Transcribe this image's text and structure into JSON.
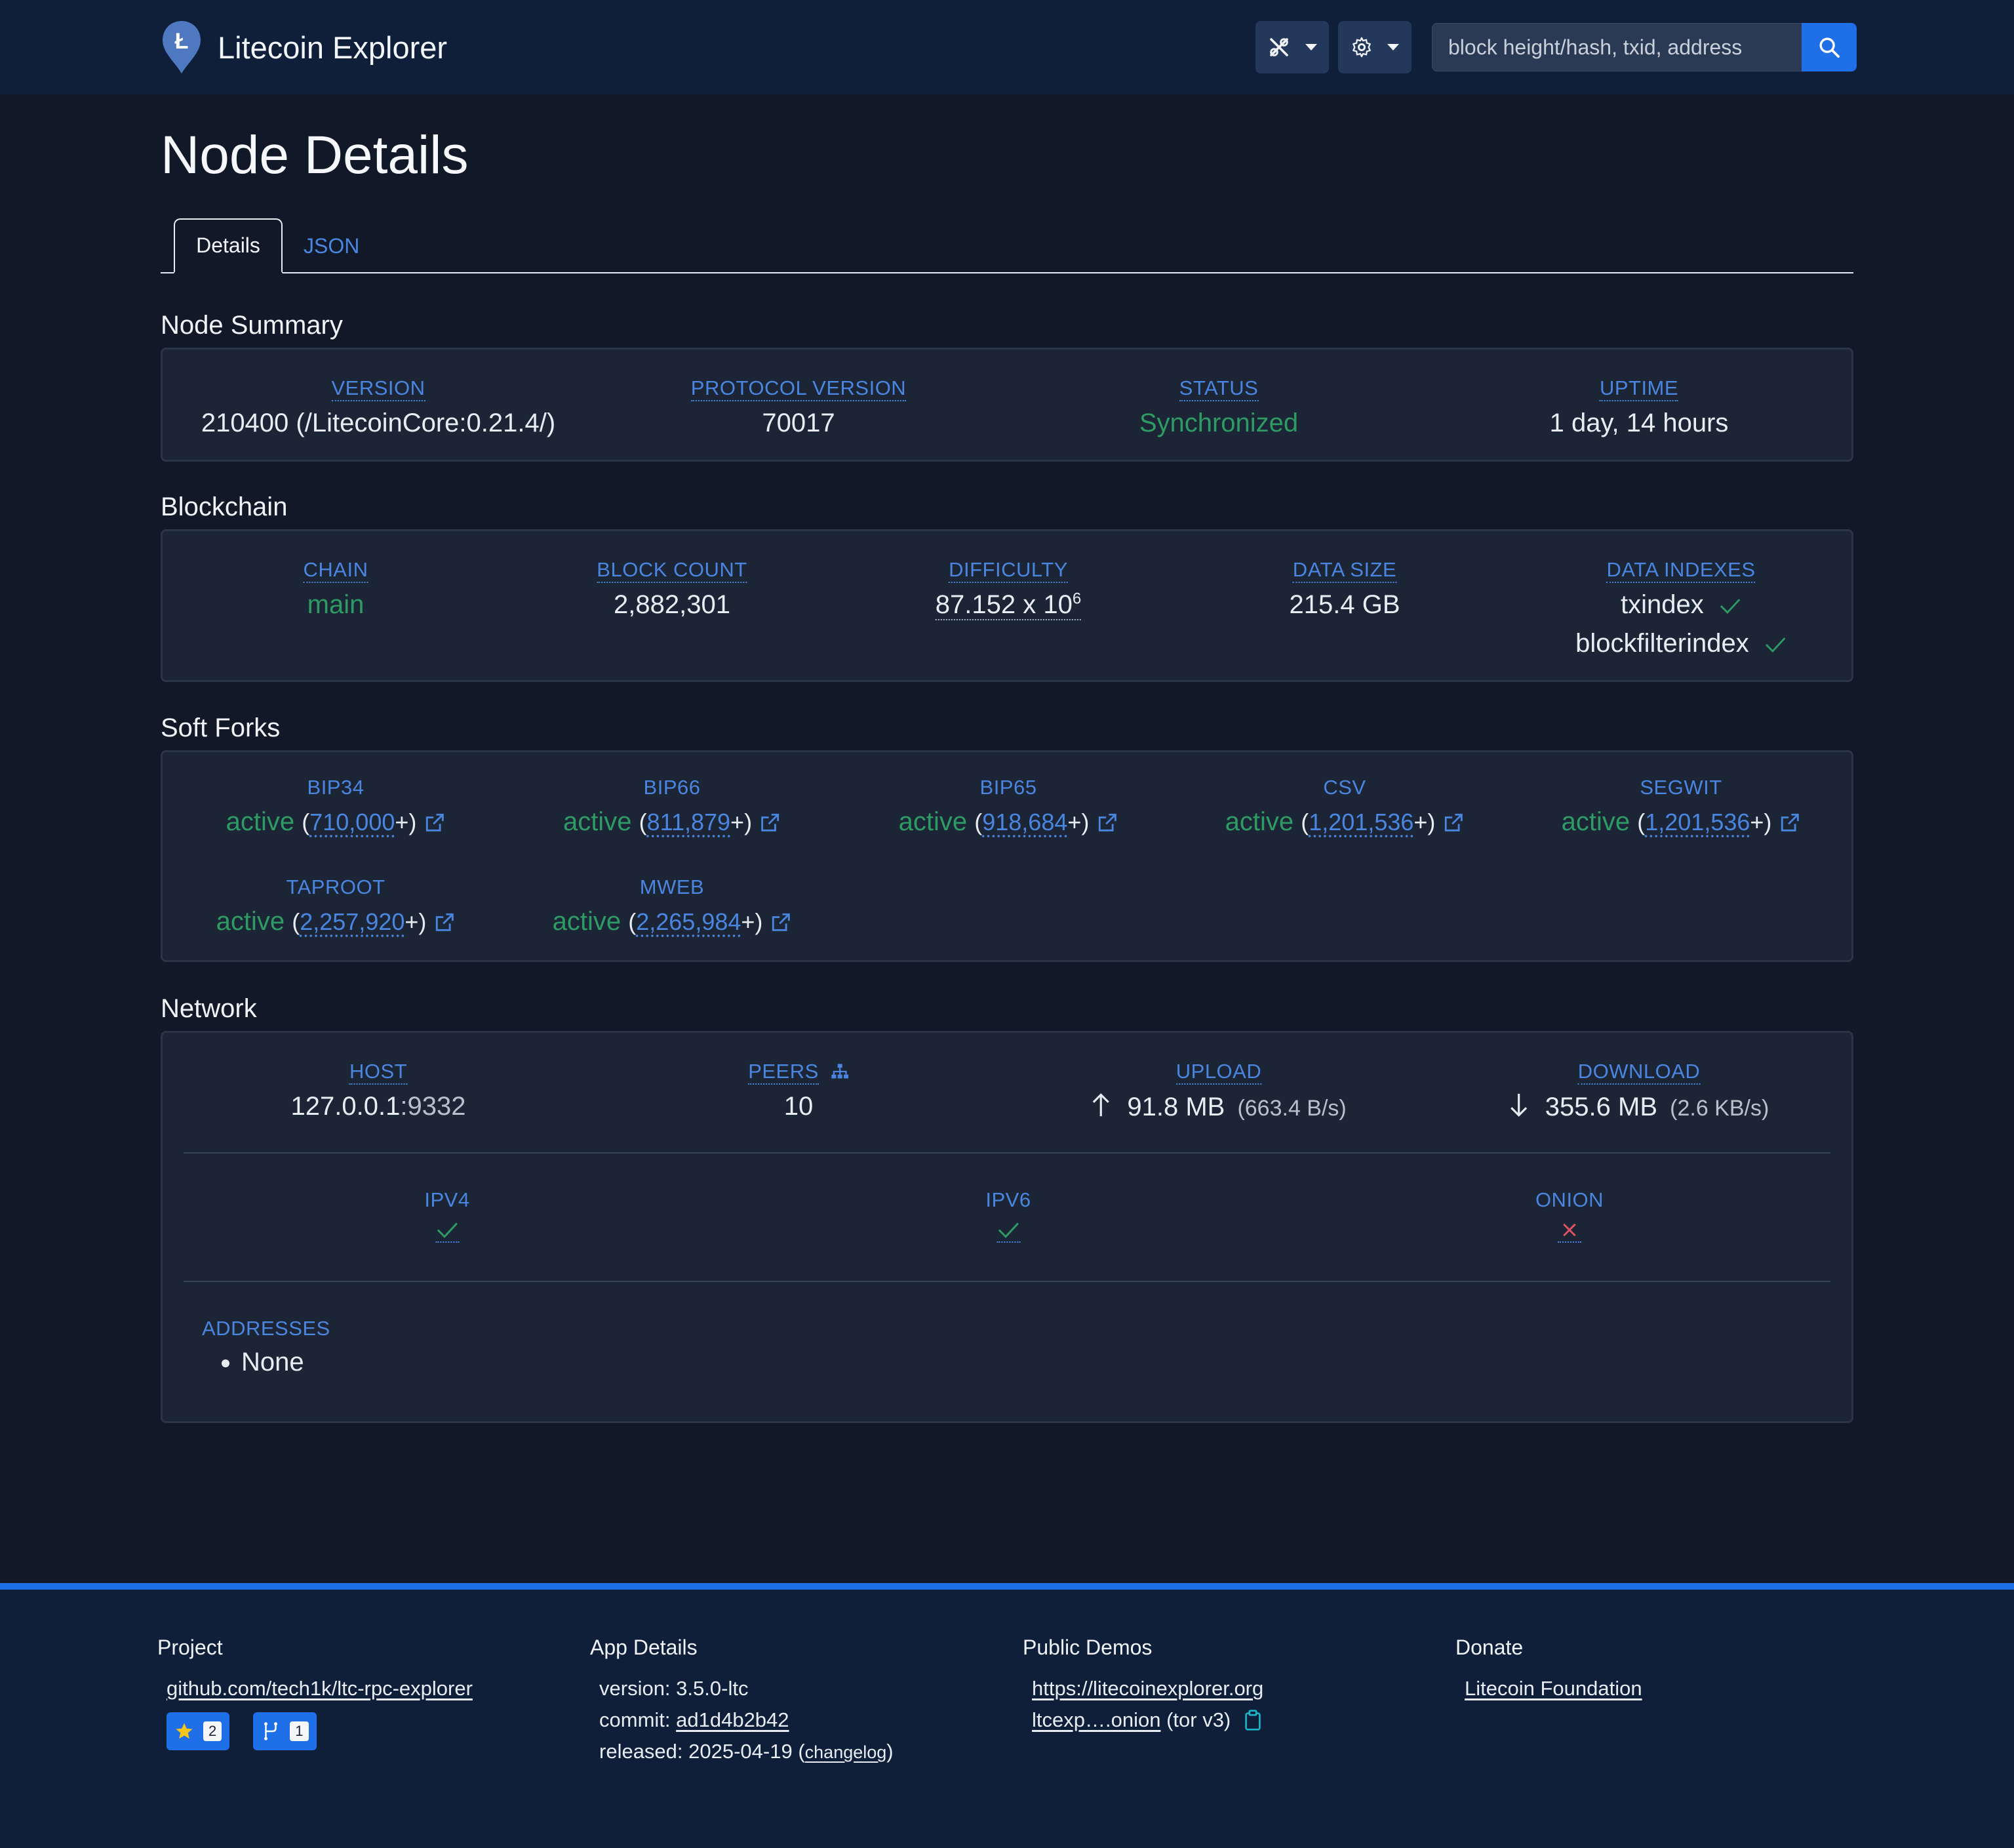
{
  "navbar": {
    "brand": "Litecoin Explorer",
    "logo_letter": "Ł",
    "search_placeholder": "block height/hash, txid, address"
  },
  "page": {
    "title": "Node Details",
    "tabs": [
      "Details",
      "JSON"
    ]
  },
  "node_summary": {
    "title": "Node Summary",
    "version_label": "VERSION",
    "version": "210400 (/LitecoinCore:0.21.4/)",
    "protocol_label": "PROTOCOL VERSION",
    "protocol": "70017",
    "status_label": "STATUS",
    "status": "Synchronized",
    "uptime_label": "UPTIME",
    "uptime": "1 day, 14 hours"
  },
  "blockchain": {
    "title": "Blockchain",
    "chain_label": "CHAIN",
    "chain": "main",
    "block_count_label": "BLOCK COUNT",
    "block_count": "2,882,301",
    "difficulty_label": "DIFFICULTY",
    "difficulty_base": "87.152 x 10",
    "difficulty_exp": "6",
    "data_size_label": "DATA SIZE",
    "data_size": "215.4 GB",
    "data_indexes_label": "DATA INDEXES",
    "data_indexes": [
      "txindex",
      "blockfilterindex"
    ]
  },
  "soft_forks": {
    "title": "Soft Forks",
    "items": [
      {
        "name": "BIP34",
        "status": "active",
        "height": "710,000"
      },
      {
        "name": "BIP66",
        "status": "active",
        "height": "811,879"
      },
      {
        "name": "BIP65",
        "status": "active",
        "height": "918,684"
      },
      {
        "name": "CSV",
        "status": "active",
        "height": "1,201,536"
      },
      {
        "name": "SEGWIT",
        "status": "active",
        "height": "1,201,536"
      },
      {
        "name": "TAPROOT",
        "status": "active",
        "height": "2,257,920"
      },
      {
        "name": "MWEB",
        "status": "active",
        "height": "2,265,984"
      }
    ]
  },
  "network": {
    "title": "Network",
    "host_label": "HOST",
    "host_ip": "127.0.0.1",
    "host_port": ":9332",
    "peers_label": "PEERS",
    "peers": "10",
    "upload_label": "UPLOAD",
    "upload": "91.8 MB",
    "upload_rate": "(663.4 B/s)",
    "download_label": "DOWNLOAD",
    "download": "355.6 MB",
    "download_rate": "(2.6 KB/s)",
    "ipv4_label": "IPV4",
    "ipv4_enabled": true,
    "ipv6_label": "IPV6",
    "ipv6_enabled": true,
    "onion_label": "ONION",
    "onion_enabled": false,
    "addresses_label": "ADDRESSES",
    "addresses": [
      "None"
    ]
  },
  "footer": {
    "project_title": "Project",
    "project_link": "github.com/tech1k/ltc-rpc-explorer",
    "stars": "2",
    "forks": "1",
    "app_title": "App Details",
    "version_prefix": "version: ",
    "version": "3.5.0-ltc",
    "commit_prefix": "commit: ",
    "commit": "ad1d4b2b42",
    "released_prefix": "released: ",
    "released": "2025-04-19",
    "changelog": "changelog",
    "demos_title": "Public Demos",
    "demo_url": "https://litecoinexplorer.org",
    "onion_short": "ltcexp….onion",
    "onion_note": "(tor v3)",
    "donate_title": "Donate",
    "donate_link": "Litecoin Foundation"
  },
  "colors": {
    "background": "#111827",
    "navbar": "#0f1f3a",
    "card": "#1c2536",
    "accent_blue": "#4a86e0",
    "button_blue": "#1f6fe8",
    "green": "#2e9a64",
    "red": "#e05260"
  }
}
